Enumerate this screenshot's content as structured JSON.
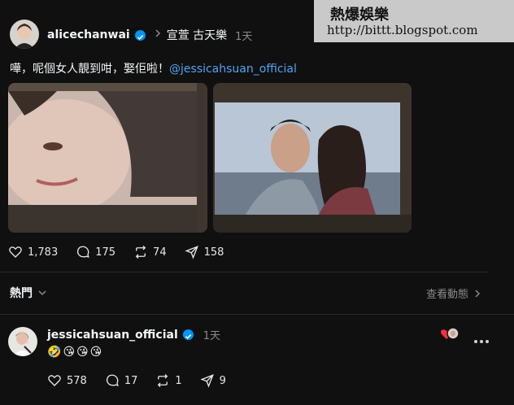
{
  "post": {
    "username": "alicechanwai",
    "tag_topic": "宣萱 古天樂",
    "time": "1天",
    "text_prefix": "嘩，呢個女人靚到咁，娶佢啦！",
    "mention": "@jessicahsuan_official",
    "stats": {
      "likes": "1,783",
      "comments": "175",
      "reposts": "74",
      "shares": "158"
    }
  },
  "sort": {
    "label": "熱門",
    "activity_link": "查看動態"
  },
  "reply": {
    "username": "jessicahsuan_official",
    "time": "1天",
    "emojis": [
      "🤣",
      "😘",
      "😘",
      "😘"
    ],
    "stats": {
      "likes": "578",
      "comments": "17",
      "reposts": "1",
      "shares": "9"
    }
  },
  "watermark": {
    "line1": "熱爆娛樂",
    "line2": "http://bittt.blogspot.com"
  },
  "icons": [
    "verified-icon",
    "chevron-right-icon",
    "heart-icon",
    "comment-icon",
    "repost-icon",
    "share-icon",
    "chevron-down-icon",
    "more-icon"
  ],
  "colors": {
    "background": "#101010",
    "mention": "#4ea3f3",
    "verified": "#0095f6",
    "muted": "#8a8a8a"
  }
}
